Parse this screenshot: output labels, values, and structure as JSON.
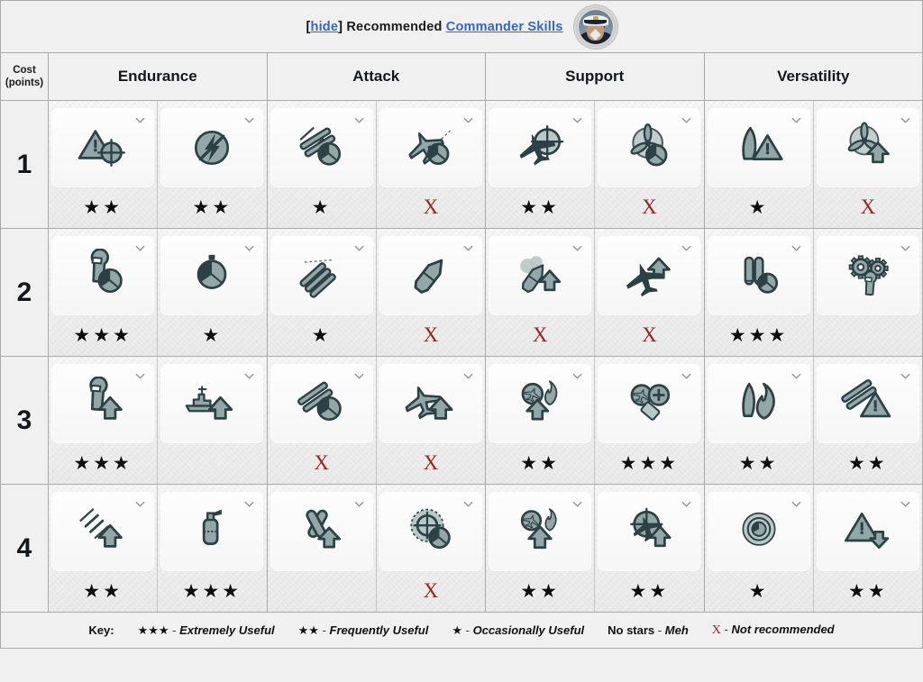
{
  "header": {
    "hide_label": "hide",
    "prefix": "Recommended",
    "link_label": "Commander Skills",
    "avatar_name": "captain-portrait"
  },
  "table": {
    "cost_header_line1": "Cost",
    "cost_header_line2": "(points)",
    "categories": [
      "Endurance",
      "Attack",
      "Support",
      "Versatility"
    ],
    "rows": [
      {
        "cost": "1",
        "cells": [
          {
            "icon": "priority-target-icon",
            "rating": "★★",
            "rating_kind": "stars",
            "chevron": "chevron-down-icon"
          },
          {
            "icon": "no-direction-blast-icon",
            "rating": "★★",
            "rating_kind": "stars",
            "chevron": "chevron-down-icon"
          },
          {
            "icon": "gun-reload-speed-icon",
            "rating": "★",
            "rating_kind": "stars",
            "chevron": "chevron-down-icon"
          },
          {
            "icon": "aircraft-timer-icon",
            "rating": "X",
            "rating_kind": "x",
            "chevron": "chevron-down-icon"
          },
          {
            "icon": "aircraft-spotter-icon",
            "rating": "★★",
            "rating_kind": "stars",
            "chevron": "chevron-down-icon"
          },
          {
            "icon": "propeller-timer-icon",
            "rating": "X",
            "rating_kind": "x",
            "chevron": "chevron-down-icon"
          },
          {
            "icon": "hull-warning-icon",
            "rating": "★",
            "rating_kind": "stars",
            "chevron": "chevron-down-icon"
          },
          {
            "icon": "propeller-boost-icon",
            "rating": "X",
            "rating_kind": "x",
            "chevron": "chevron-down-icon"
          }
        ]
      },
      {
        "cost": "2",
        "cells": [
          {
            "icon": "wrench-timer-icon",
            "rating": "★★★",
            "rating_kind": "stars",
            "chevron": "chevron-down-icon"
          },
          {
            "icon": "stopwatch-icon",
            "rating": "★",
            "rating_kind": "stars",
            "chevron": "chevron-down-icon"
          },
          {
            "icon": "torpedo-arc-icon",
            "rating": "★",
            "rating_kind": "stars",
            "chevron": "chevron-down-icon"
          },
          {
            "icon": "shell-boost-icon",
            "rating": "X",
            "rating_kind": "x",
            "chevron": "chevron-down-icon"
          },
          {
            "icon": "smoke-boost-icon",
            "rating": "X",
            "rating_kind": "x",
            "chevron": "chevron-down-icon"
          },
          {
            "icon": "aircraft-boost-icon",
            "rating": "X",
            "rating_kind": "x",
            "chevron": "chevron-down-icon"
          },
          {
            "icon": "torpedo-tubes-timer-icon",
            "rating": "★★★",
            "rating_kind": "stars",
            "chevron": "chevron-down-icon"
          },
          {
            "icon": "gears-wrench-icon",
            "rating": "",
            "rating_kind": "none",
            "chevron": "chevron-down-icon"
          }
        ]
      },
      {
        "cost": "3",
        "cells": [
          {
            "icon": "wrench-boost-icon",
            "rating": "★★★",
            "rating_kind": "stars",
            "chevron": "chevron-down-icon"
          },
          {
            "icon": "carrier-boost-icon",
            "rating": "",
            "rating_kind": "none",
            "chevron": "chevron-down-icon"
          },
          {
            "icon": "main-battery-timer-icon",
            "rating": "X",
            "rating_kind": "x",
            "chevron": "chevron-down-icon"
          },
          {
            "icon": "aircraft-armor-boost-icon",
            "rating": "X",
            "rating_kind": "x",
            "chevron": "chevron-down-icon"
          },
          {
            "icon": "aa-flak-boost-icon",
            "rating": "★★",
            "rating_kind": "stars",
            "chevron": "chevron-down-icon"
          },
          {
            "icon": "aa-plus-icon",
            "rating": "★★★",
            "rating_kind": "stars",
            "chevron": "chevron-down-icon"
          },
          {
            "icon": "fire-prevention-icon",
            "rating": "★★",
            "rating_kind": "stars",
            "chevron": "chevron-down-icon"
          },
          {
            "icon": "gun-warning-icon",
            "rating": "★★",
            "rating_kind": "stars",
            "chevron": "chevron-down-icon"
          }
        ]
      },
      {
        "cost": "4",
        "cells": [
          {
            "icon": "speed-boost-icon",
            "rating": "★★",
            "rating_kind": "stars",
            "chevron": "chevron-down-icon"
          },
          {
            "icon": "fire-extinguisher-icon",
            "rating": "★★★",
            "rating_kind": "stars",
            "chevron": "chevron-down-icon"
          },
          {
            "icon": "torpedo-cross-boost-icon",
            "rating": "",
            "rating_kind": "none",
            "chevron": "chevron-down-icon"
          },
          {
            "icon": "radar-timer-icon",
            "rating": "X",
            "rating_kind": "x",
            "chevron": "chevron-down-icon"
          },
          {
            "icon": "aa-flak-arrow-icon",
            "rating": "★★",
            "rating_kind": "stars",
            "chevron": "chevron-down-icon"
          },
          {
            "icon": "fighter-boost-icon",
            "rating": "★★",
            "rating_kind": "stars",
            "chevron": "chevron-down-icon"
          },
          {
            "icon": "radar-sonar-icon",
            "rating": "★",
            "rating_kind": "stars",
            "chevron": "chevron-down-icon"
          },
          {
            "icon": "warning-down-icon",
            "rating": "★★",
            "rating_kind": "stars",
            "chevron": "chevron-down-icon"
          }
        ]
      }
    ]
  },
  "key": {
    "label": "Key:",
    "items": [
      {
        "symbol": "★★★",
        "kind": "stars",
        "dash": "-",
        "text": "Extremely Useful"
      },
      {
        "symbol": "★★",
        "kind": "stars",
        "dash": "-",
        "text": "Frequently Useful"
      },
      {
        "symbol": "★",
        "kind": "stars",
        "dash": "-",
        "text": "Occasionally Useful"
      },
      {
        "symbol": "No stars",
        "kind": "word",
        "dash": "-",
        "text": "Meh"
      },
      {
        "symbol": "X",
        "kind": "x",
        "dash": "-",
        "text": "Not recommended"
      }
    ]
  },
  "colors": {
    "link": "#3366cc",
    "x_red": "#9c2020",
    "icon_dark": "#2b4146",
    "icon_fill": "#8ea2a4",
    "border": "#a9a9a9",
    "page_bg": "#f0f0f0"
  }
}
